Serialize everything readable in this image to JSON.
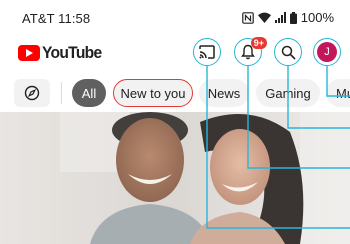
{
  "status": {
    "carrier_time": "AT&T 11:58",
    "battery": "100%",
    "icons": [
      "nfc-icon",
      "wifi-icon",
      "signal-icon",
      "battery-icon"
    ]
  },
  "header": {
    "logo_text": "YouTube",
    "cast_icon": "cast-icon",
    "notifications_icon": "bell-icon",
    "notification_badge": "9+",
    "search_icon": "search-icon",
    "avatar_initial": "J"
  },
  "chips": {
    "explore_icon": "compass-icon",
    "items": [
      {
        "label": "All",
        "selected": true
      },
      {
        "label": "New to you",
        "selected": false
      },
      {
        "label": "News",
        "selected": false
      },
      {
        "label": "Gaming",
        "selected": false
      },
      {
        "label": "Mu",
        "selected": false
      }
    ]
  },
  "colors": {
    "brand_red": "#ff0000",
    "highlight": "#29b6d9",
    "selected_chip": "#606060",
    "avatar": "#c2185b",
    "badge": "#e53935"
  }
}
